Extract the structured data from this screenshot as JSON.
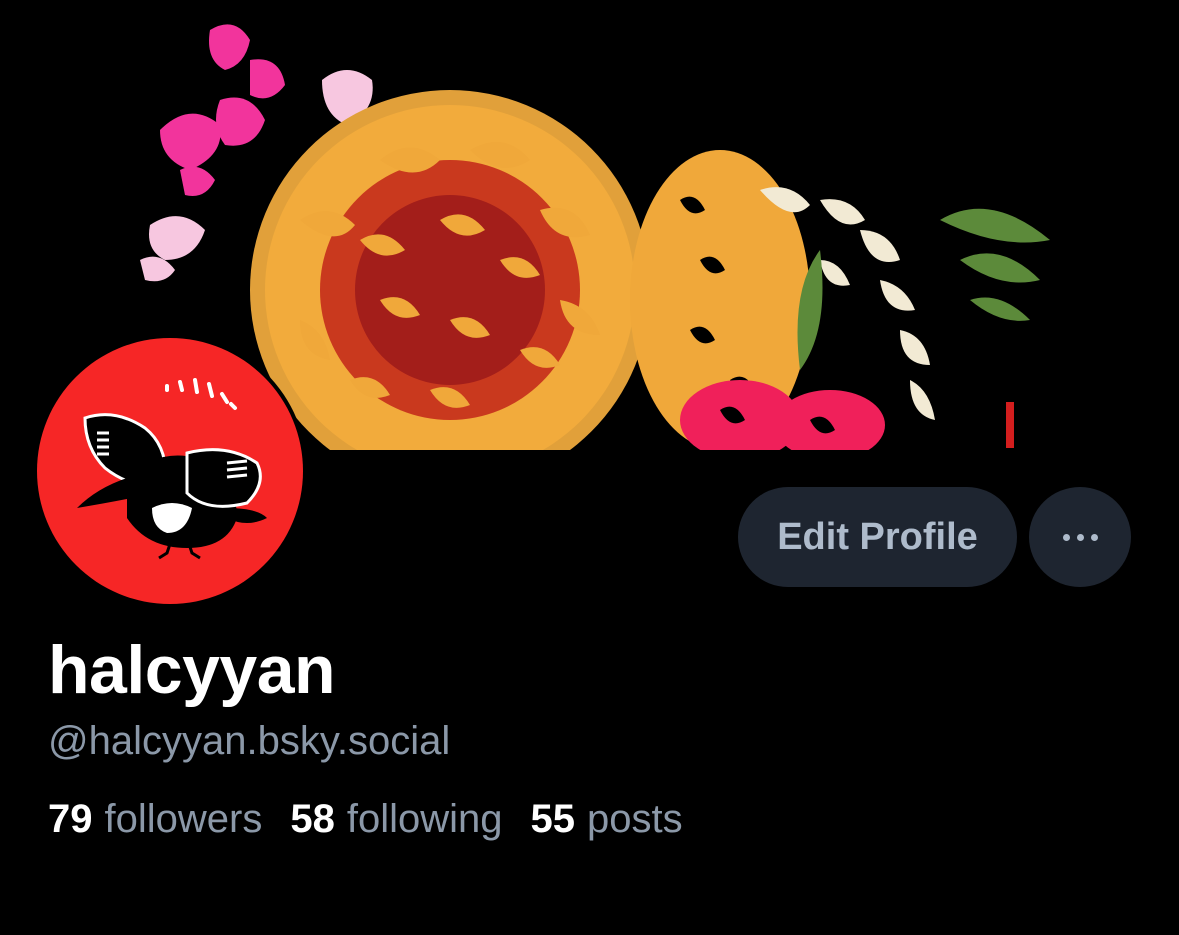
{
  "profile": {
    "display_name": "halcyyan",
    "handle": "@halcyyan.bsky.social",
    "avatar": "magpie-bird-illustration",
    "banner": "flower-bouquet-illustration"
  },
  "actions": {
    "edit_profile_label": "Edit Profile",
    "more_icon": "ellipsis-icon"
  },
  "stats": {
    "followers": {
      "count": "79",
      "label": "followers"
    },
    "following": {
      "count": "58",
      "label": "following"
    },
    "posts": {
      "count": "55",
      "label": "posts"
    }
  },
  "colors": {
    "background": "#000000",
    "avatar_bg": "#f62626",
    "button_bg": "#1e2530",
    "button_text": "#aebbcb",
    "secondary_text": "#8b98a8"
  }
}
